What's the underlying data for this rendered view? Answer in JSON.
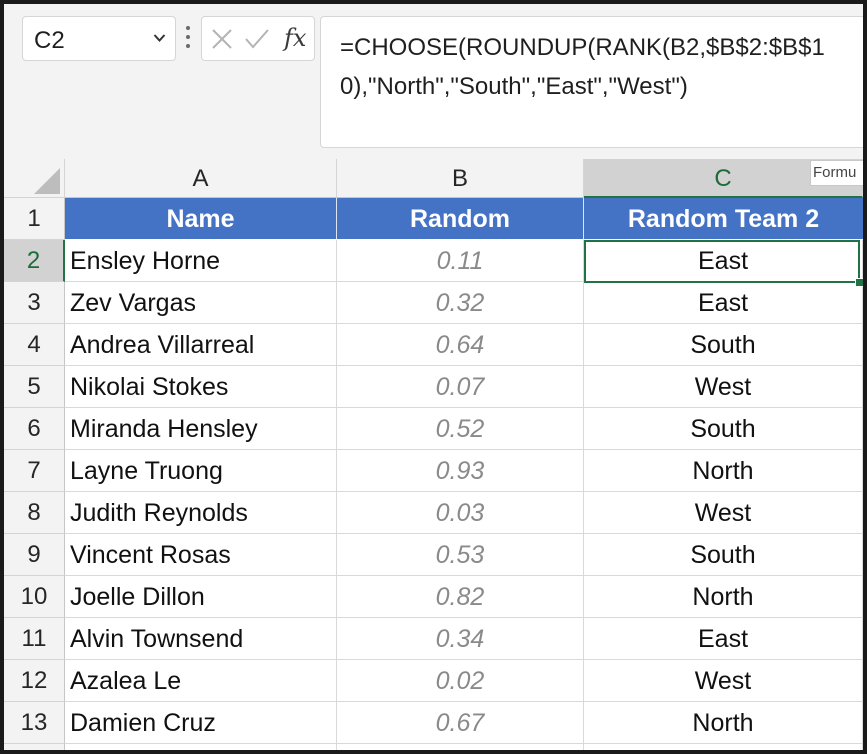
{
  "name_box": {
    "value": "C2"
  },
  "formula_bar": {
    "fx_label": "fx",
    "formula_line1": "=CHOOSE(ROUNDUP(RANK(B2,$B$2:$B$1",
    "formula_line2": "0),\"North\",\"South\",\"East\",\"West\")"
  },
  "tooltip": {
    "text": "Formu"
  },
  "columns": [
    {
      "letter": "A"
    },
    {
      "letter": "B"
    },
    {
      "letter": "C",
      "selected": true
    }
  ],
  "header_row": {
    "name": "Name",
    "random": "Random",
    "team": "Random Team 2"
  },
  "rows": [
    {
      "num": "1"
    },
    {
      "num": "2",
      "name": "Ensley Horne",
      "random": "0.11",
      "team": "East"
    },
    {
      "num": "3",
      "name": "Zev Vargas",
      "random": "0.32",
      "team": "East"
    },
    {
      "num": "4",
      "name": "Andrea Villarreal",
      "random": "0.64",
      "team": "South"
    },
    {
      "num": "5",
      "name": "Nikolai Stokes",
      "random": "0.07",
      "team": "West"
    },
    {
      "num": "6",
      "name": "Miranda Hensley",
      "random": "0.52",
      "team": "South"
    },
    {
      "num": "7",
      "name": "Layne Truong",
      "random": "0.93",
      "team": "North"
    },
    {
      "num": "8",
      "name": "Judith Reynolds",
      "random": "0.03",
      "team": "West"
    },
    {
      "num": "9",
      "name": "Vincent Rosas",
      "random": "0.53",
      "team": "South"
    },
    {
      "num": "10",
      "name": "Joelle Dillon",
      "random": "0.82",
      "team": "North"
    },
    {
      "num": "11",
      "name": "Alvin Townsend",
      "random": "0.34",
      "team": "East"
    },
    {
      "num": "12",
      "name": "Azalea Le",
      "random": "0.02",
      "team": "West"
    },
    {
      "num": "13",
      "name": "Damien Cruz",
      "random": "0.67",
      "team": "North"
    }
  ],
  "colors": {
    "header_fill": "#4472c4",
    "selection_accent": "#217346",
    "random_text": "#8a8a8a"
  }
}
